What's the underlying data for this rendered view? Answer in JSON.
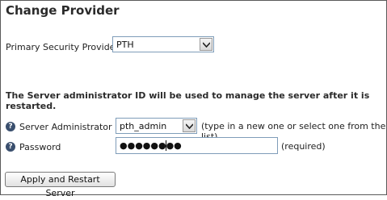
{
  "title": "Change Provider",
  "primary_provider": {
    "label": "Primary Security Provider:",
    "selected": "PTH"
  },
  "notice": "The Server administrator ID will be used to manage the server after it is restarted.",
  "admin_id": {
    "help_glyph": "?",
    "label": "Server Administrator ID",
    "selected": "pth_admin",
    "hint": "(type in a new one or select one from the list)"
  },
  "password": {
    "help_glyph": "?",
    "label": "Password",
    "masked_value": "●●●●●●●●",
    "hint": "(required)"
  },
  "apply_button": "Apply and Restart Server"
}
